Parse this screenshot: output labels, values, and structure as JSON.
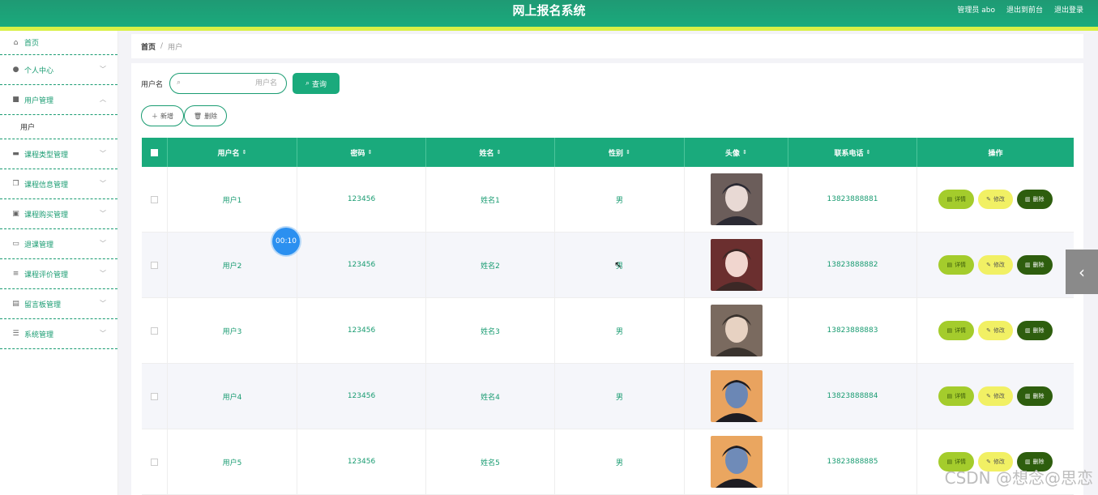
{
  "app": {
    "title": "网上报名系统",
    "top_links": [
      "管理员 abo",
      "退出到前台",
      "退出登录"
    ]
  },
  "sidebar": {
    "items": [
      {
        "label": "首页",
        "icon": "home-icon",
        "glyph": "⌂"
      },
      {
        "label": "个人中心",
        "icon": "user-icon",
        "glyph": "●"
      },
      {
        "label": "用户管理",
        "icon": "users-icon",
        "glyph": "■",
        "expanded": true,
        "sub": [
          "用户"
        ]
      },
      {
        "label": "课程类型管理",
        "icon": "chat-icon",
        "glyph": "▬"
      },
      {
        "label": "课程信息管理",
        "icon": "copy-icon",
        "glyph": "❐"
      },
      {
        "label": "课程购买管理",
        "icon": "clipboard-icon",
        "glyph": "▣"
      },
      {
        "label": "退课管理",
        "icon": "message-icon",
        "glyph": "▭"
      },
      {
        "label": "课程评价管理",
        "icon": "list-icon",
        "glyph": "≡"
      },
      {
        "label": "留言板管理",
        "icon": "briefcase-icon",
        "glyph": "▤"
      },
      {
        "label": "系统管理",
        "icon": "sliders-icon",
        "glyph": "☰"
      }
    ]
  },
  "breadcrumb": {
    "home": "首页",
    "sep": "/",
    "current": "用户"
  },
  "search": {
    "label": "用户名",
    "placeholder": "用户名",
    "button": "查询"
  },
  "actions": {
    "add": "新增",
    "delete": "删除"
  },
  "table": {
    "columns": [
      "用户名",
      "密码",
      "姓名",
      "性别",
      "头像",
      "联系电话",
      "操作"
    ],
    "rows": [
      {
        "username": "用户1",
        "password": "123456",
        "name": "姓名1",
        "gender": "男",
        "phone": "13823888881",
        "avatar_colors": [
          "#6b5d5a",
          "#e8d9d4",
          "#2b2a33"
        ]
      },
      {
        "username": "用户2",
        "password": "123456",
        "name": "姓名2",
        "gender": "男",
        "phone": "13823888882",
        "avatar_colors": [
          "#6b2f2f",
          "#f1d6cf",
          "#3c2826"
        ]
      },
      {
        "username": "用户3",
        "password": "123456",
        "name": "姓名3",
        "gender": "男",
        "phone": "13823888883",
        "avatar_colors": [
          "#7a6a5f",
          "#e7d2c2",
          "#3a332e"
        ]
      },
      {
        "username": "用户4",
        "password": "123456",
        "name": "姓名4",
        "gender": "男",
        "phone": "13823888884",
        "avatar_colors": [
          "#e9a35f",
          "#6b87b5",
          "#1d1c22"
        ]
      },
      {
        "username": "用户5",
        "password": "123456",
        "name": "姓名5",
        "gender": "男",
        "phone": "13823888885",
        "avatar_colors": [
          "#eaa660",
          "#6f8bb8",
          "#1e1d23"
        ]
      }
    ],
    "ops": {
      "detail": "详情",
      "edit": "修改",
      "delete": "删除"
    }
  },
  "overlay": {
    "timer": "00:10",
    "watermark": "CSDN @想念@思恋"
  },
  "colors": {
    "primary": "#1aaa7c",
    "accent_line": "#d9f046",
    "detail": "#a4cc2c",
    "edit": "#f1f064",
    "delete": "#2e5e0e"
  }
}
